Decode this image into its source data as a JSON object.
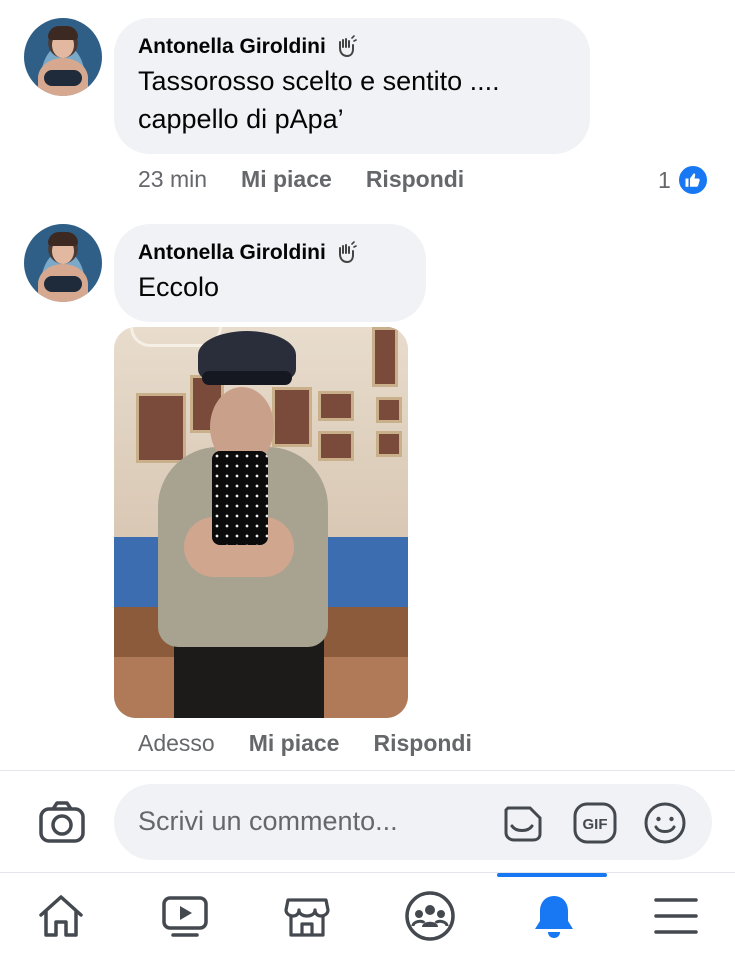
{
  "comments": [
    {
      "author": "Antonella Giroldini",
      "text_line1": "Tassorosso scelto e sentito ....",
      "text_line2": "cappello di pApa’",
      "time": "23 min",
      "like_label": "Mi piace",
      "reply_label": "Rispondi",
      "reaction_count": "1"
    },
    {
      "author": "Antonella Giroldini",
      "text_line1": "Eccolo",
      "time": "Adesso",
      "like_label": "Mi piace",
      "reply_label": "Rispondi",
      "has_photo": true
    }
  ],
  "composer": {
    "placeholder": "Scrivi un commento..."
  },
  "tabbar": {
    "items": [
      "home-icon",
      "watch-icon",
      "marketplace-icon",
      "groups-icon",
      "notifications-icon",
      "menu-icon"
    ],
    "active": "notifications-icon"
  },
  "colors": {
    "accent": "#1877f2",
    "bubble": "#f0f2f5",
    "secondary_text": "#65676b"
  }
}
